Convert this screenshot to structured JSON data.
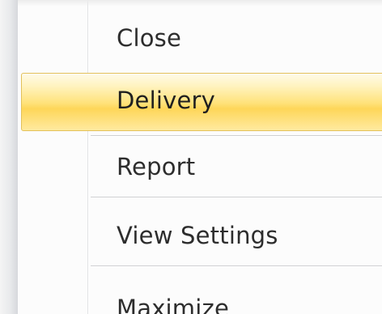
{
  "menu": {
    "items": [
      {
        "label": "Close"
      },
      {
        "label": "Delivery"
      },
      {
        "label": "Report"
      },
      {
        "label": "View Settings"
      },
      {
        "label": "Maximize"
      }
    ],
    "highlighted_item": "Delivery",
    "highlight_color": "#ffe27a",
    "highlight_border_color": "#e3c15a"
  }
}
